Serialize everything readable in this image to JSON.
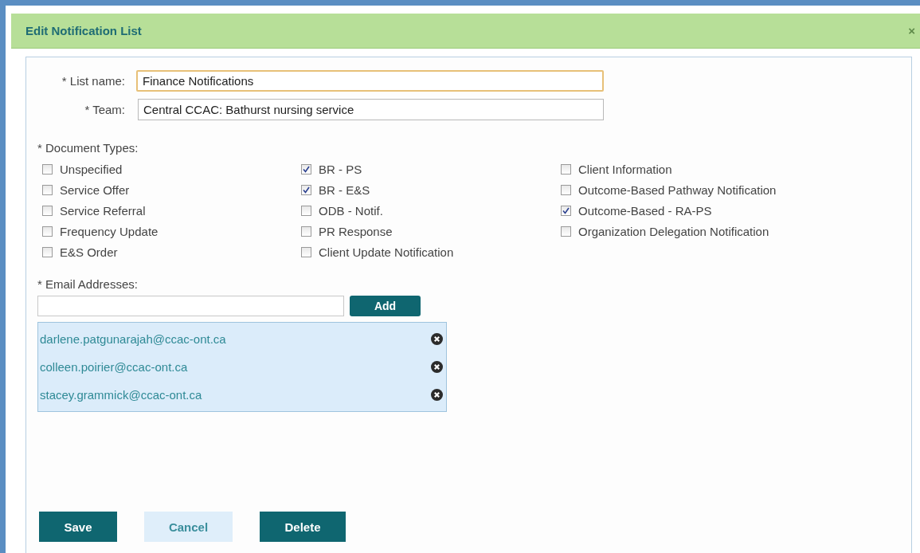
{
  "dialog": {
    "title": "Edit Notification List",
    "close": "×"
  },
  "fields": [
    {
      "label": "* List name:",
      "value": "Finance Notifications",
      "focused": true
    },
    {
      "label": "* Team:",
      "value": "Central CCAC: Bathurst nursing service",
      "focused": false
    }
  ],
  "document_types": {
    "label": "* Document Types:",
    "columns": [
      [
        {
          "label": "Unspecified",
          "checked": false
        },
        {
          "label": "Service Offer",
          "checked": false
        },
        {
          "label": "Service Referral",
          "checked": false
        },
        {
          "label": "Frequency Update",
          "checked": false
        },
        {
          "label": "E&S Order",
          "checked": false
        }
      ],
      [
        {
          "label": "BR - PS",
          "checked": true
        },
        {
          "label": "BR - E&S",
          "checked": true
        },
        {
          "label": "ODB - Notif.",
          "checked": false
        },
        {
          "label": "PR Response",
          "checked": false
        },
        {
          "label": "Client Update Notification",
          "checked": false
        }
      ],
      [
        {
          "label": "Client Information",
          "checked": false
        },
        {
          "label": "Outcome-Based Pathway Notification",
          "checked": false
        },
        {
          "label": "Outcome-Based - RA-PS",
          "checked": true
        },
        {
          "label": "Organization Delegation Notification",
          "checked": false
        }
      ]
    ]
  },
  "email": {
    "label": "* Email Addresses:",
    "add_button": "Add",
    "addresses": [
      "darlene.patgunarajah@ccac-ont.ca",
      "colleen.poirier@ccac-ont.ca",
      "stacey.grammick@ccac-ont.ca"
    ]
  },
  "buttons": [
    {
      "label": "Save",
      "kind": "primary"
    },
    {
      "label": "Cancel",
      "kind": "secondary"
    },
    {
      "label": "Delete",
      "kind": "primary"
    }
  ]
}
